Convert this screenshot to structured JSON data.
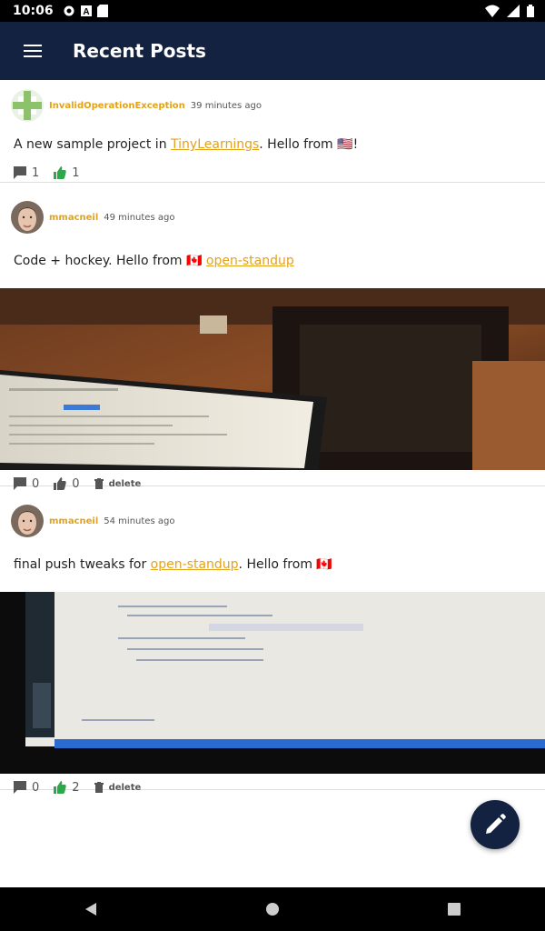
{
  "status_bar": {
    "time": "10:06"
  },
  "app_bar": {
    "title": "Recent Posts"
  },
  "posts": [
    {
      "username": "InvalidOperationException",
      "time_ago": "39 minutes ago",
      "text_before": "A new sample project in ",
      "link": "TinyLearnings",
      "text_after": ". Hello from 🇺🇸!",
      "comments": "1",
      "likes": "1"
    },
    {
      "username": "mmacneil",
      "time_ago": "49 minutes ago",
      "text_before": "Code + hockey. Hello from 🇨🇦 ",
      "link": "open-standup",
      "text_after": "",
      "comments": "0",
      "likes": "0",
      "delete_label": "delete"
    },
    {
      "username": "mmacneil",
      "time_ago": "54 minutes ago",
      "text_before": "final push tweaks for ",
      "link": "open-standup",
      "text_after": ". Hello from 🇨🇦",
      "comments": "0",
      "likes": "2",
      "delete_label": "delete"
    }
  ],
  "colors": {
    "app_bar": "#142241",
    "username": "#e3a21a",
    "liked": "#2aa84a",
    "fab": "#142241"
  },
  "icons": {
    "menu": "menu-icon",
    "comment": "comment-icon",
    "like": "thumbs-up-icon",
    "delete": "trash-icon",
    "compose": "pencil-icon"
  }
}
